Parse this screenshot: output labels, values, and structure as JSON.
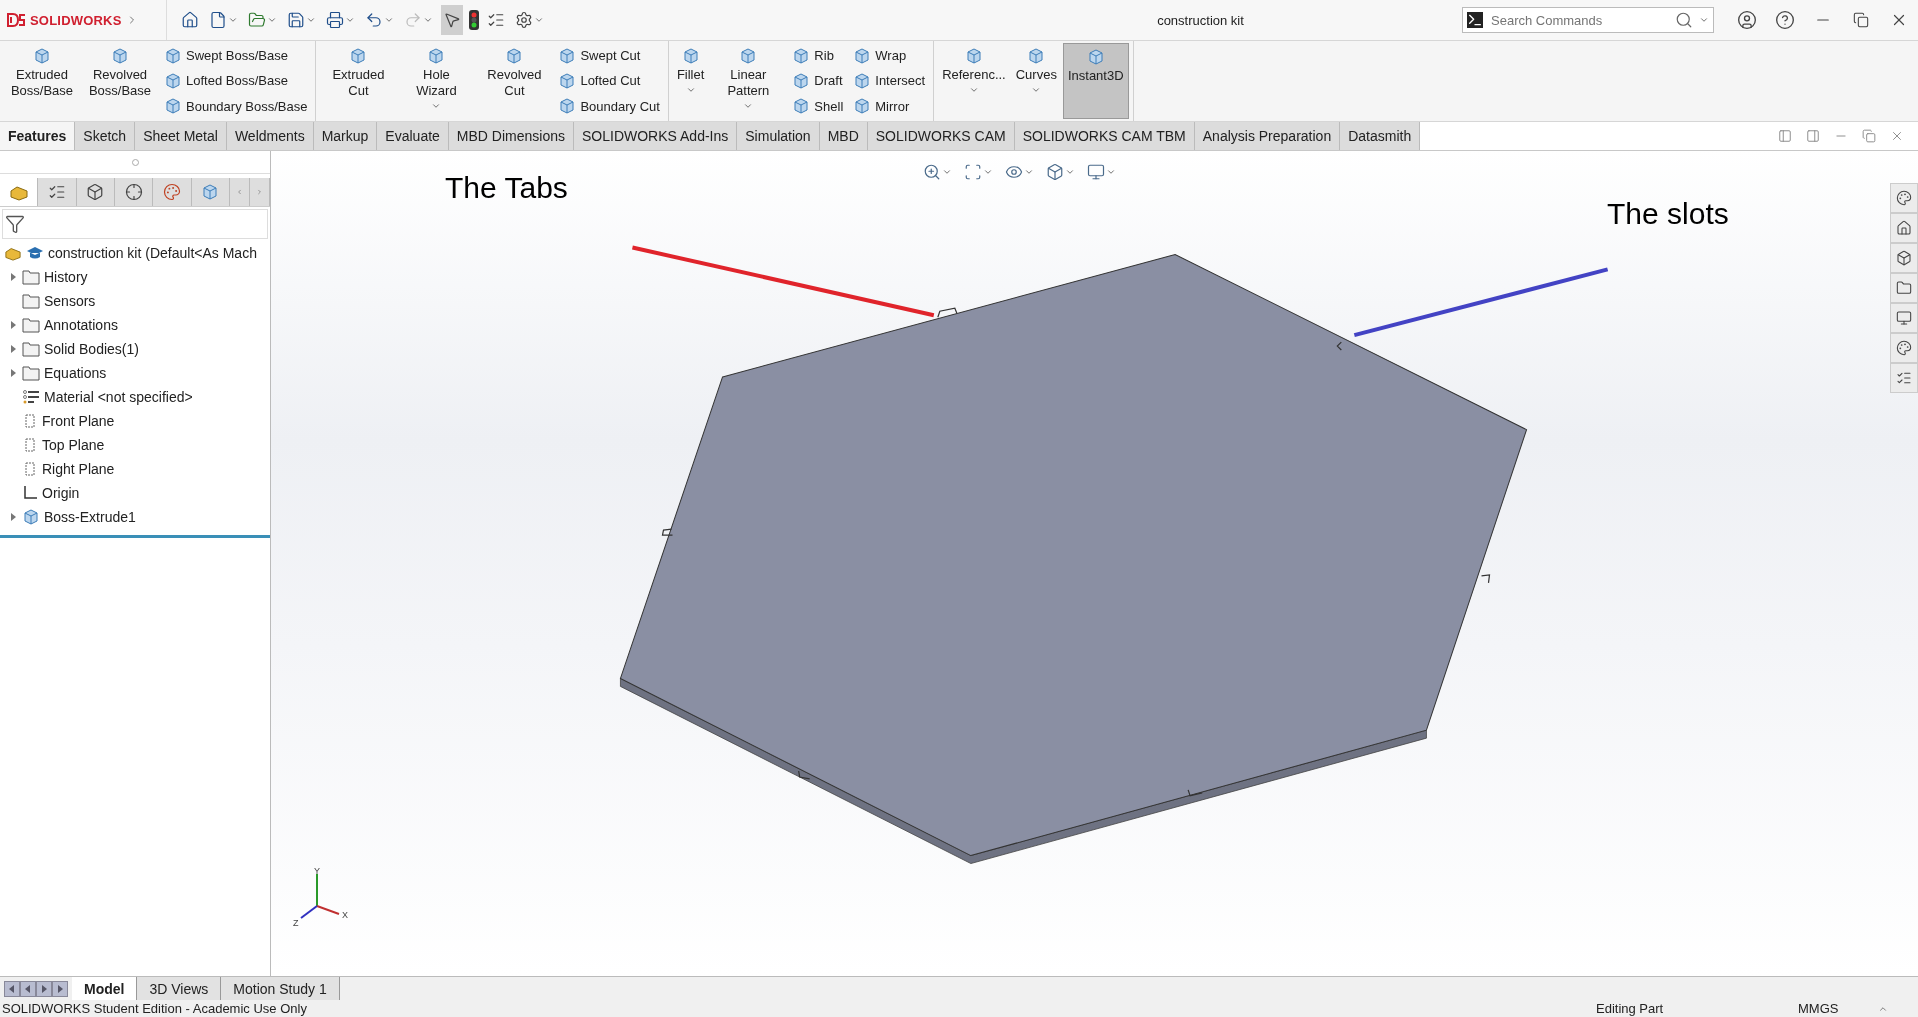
{
  "app": {
    "logo": "SOLIDWORKS"
  },
  "window": {
    "title": "construction kit"
  },
  "search": {
    "placeholder": "Search Commands"
  },
  "ribbon": {
    "groups": [
      {
        "columns": [
          {
            "kind": "large",
            "label": "Extruded Boss/Base",
            "menu": false,
            "selected": false
          },
          {
            "kind": "large",
            "label": "Revolved Boss/Base",
            "menu": false,
            "selected": false
          },
          {
            "kind": "stack",
            "items": [
              "Swept Boss/Base",
              "Lofted Boss/Base",
              "Boundary Boss/Base"
            ]
          }
        ]
      },
      {
        "columns": [
          {
            "kind": "large",
            "label": "Extruded Cut",
            "menu": false,
            "selected": false
          },
          {
            "kind": "large",
            "label": "Hole Wizard",
            "menu": true,
            "selected": false
          },
          {
            "kind": "large",
            "label": "Revolved Cut",
            "menu": false,
            "selected": false
          },
          {
            "kind": "stack",
            "items": [
              "Swept Cut",
              "Lofted Cut",
              "Boundary Cut"
            ]
          }
        ]
      },
      {
        "columns": [
          {
            "kind": "large",
            "label": "Fillet",
            "menu": true,
            "selected": false
          },
          {
            "kind": "large",
            "label": "Linear Pattern",
            "menu": true,
            "selected": false
          },
          {
            "kind": "stack",
            "items": [
              "Rib",
              "Draft",
              "Shell"
            ]
          },
          {
            "kind": "stack",
            "items": [
              "Wrap",
              "Intersect",
              "Mirror"
            ]
          }
        ]
      },
      {
        "columns": [
          {
            "kind": "large",
            "label": "Referenc...",
            "menu": true,
            "selected": false
          },
          {
            "kind": "large",
            "label": "Curves",
            "menu": true,
            "selected": false
          },
          {
            "kind": "large",
            "label": "Instant3D",
            "menu": false,
            "selected": true
          }
        ]
      }
    ]
  },
  "command_tabs": [
    {
      "label": "Features",
      "selected": true
    },
    {
      "label": "Sketch",
      "selected": false
    },
    {
      "label": "Sheet Metal",
      "selected": false
    },
    {
      "label": "Weldments",
      "selected": false
    },
    {
      "label": "Markup",
      "selected": false
    },
    {
      "label": "Evaluate",
      "selected": false
    },
    {
      "label": "MBD Dimensions",
      "selected": false
    },
    {
      "label": "SOLIDWORKS Add-Ins",
      "selected": false
    },
    {
      "label": "Simulation",
      "selected": false
    },
    {
      "label": "MBD",
      "selected": false
    },
    {
      "label": "SOLIDWORKS CAM",
      "selected": false
    },
    {
      "label": "SOLIDWORKS CAM TBM",
      "selected": false
    },
    {
      "label": "Analysis Preparation",
      "selected": false
    },
    {
      "label": "Datasmith",
      "selected": false
    }
  ],
  "panel_tabs": [
    {
      "selected": true
    },
    {
      "selected": false
    },
    {
      "selected": false
    },
    {
      "selected": false
    },
    {
      "selected": false
    },
    {
      "selected": false
    }
  ],
  "feature_tree": {
    "root": "construction kit (Default<As Mach",
    "items": [
      {
        "kind": "folder",
        "label": "History",
        "expander": true
      },
      {
        "kind": "folder",
        "label": "Sensors",
        "expander": false
      },
      {
        "kind": "folder",
        "label": "Annotations",
        "expander": true
      },
      {
        "kind": "folder",
        "label": "Solid Bodies(1)",
        "expander": true
      },
      {
        "kind": "folder",
        "label": "Equations",
        "expander": true
      },
      {
        "kind": "material",
        "label": "Material <not specified>",
        "expander": false
      },
      {
        "kind": "plane",
        "label": "Front Plane",
        "expander": false
      },
      {
        "kind": "plane",
        "label": "Top Plane",
        "expander": false
      },
      {
        "kind": "plane",
        "label": "Right Plane",
        "expander": false
      },
      {
        "kind": "origin",
        "label": "Origin",
        "expander": false
      },
      {
        "kind": "feature",
        "label": "Boss-Extrude1",
        "expander": true
      }
    ]
  },
  "annotations": [
    {
      "text": "The Tabs",
      "color": "#e0242b"
    },
    {
      "text": "The slots",
      "color": "#4343c4"
    }
  ],
  "triad": {
    "x": "X",
    "y": "Y",
    "z": "Z"
  },
  "bottom_tabs": [
    {
      "label": "Model",
      "selected": true
    },
    {
      "label": "3D Views",
      "selected": false
    },
    {
      "label": "Motion Study 1",
      "selected": false
    }
  ],
  "status": {
    "left": "SOLIDWORKS Student Edition - Academic Use Only",
    "mode": "Editing Part",
    "units": "MMGS"
  }
}
